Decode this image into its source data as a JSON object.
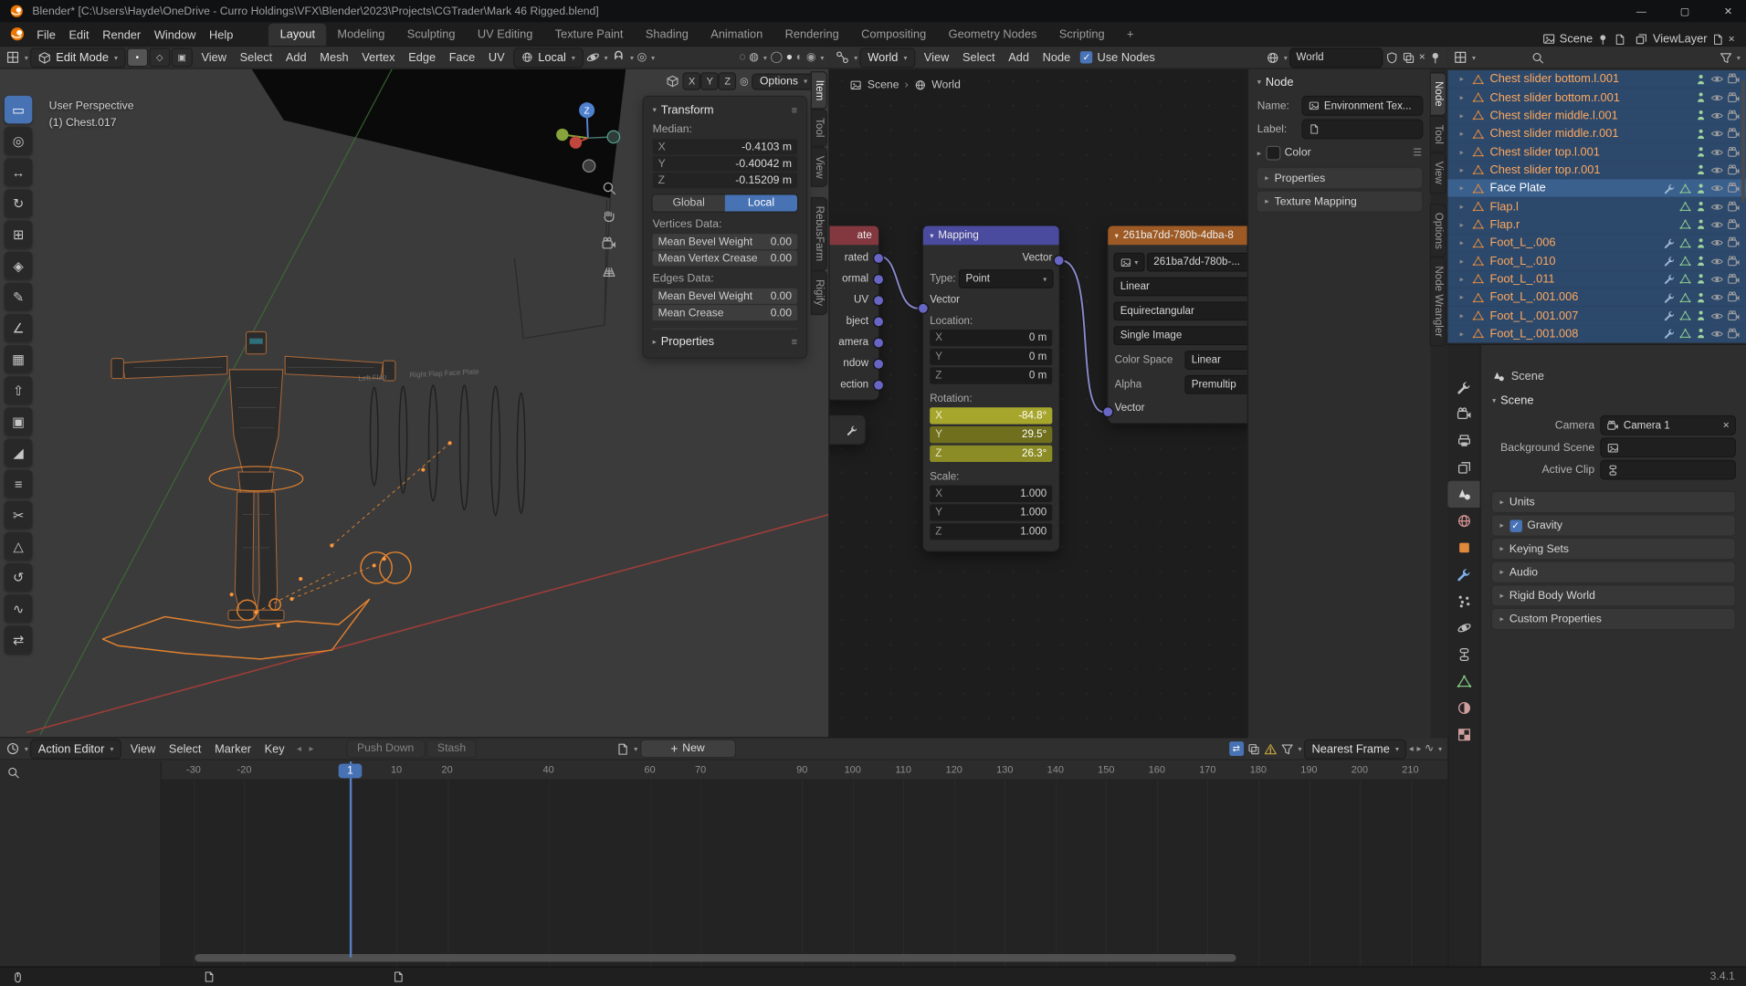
{
  "window": {
    "title": "Blender* [C:\\Users\\Hayde\\OneDrive - Curro Holdings\\VFX\\Blender\\2023\\Projects\\CGTrader\\Mark 46 Rigged.blend]"
  },
  "topbar": {
    "menus": [
      "File",
      "Edit",
      "Render",
      "Window",
      "Help"
    ],
    "workspaces": [
      "Layout",
      "Modeling",
      "Sculpting",
      "UV Editing",
      "Texture Paint",
      "Shading",
      "Animation",
      "Rendering",
      "Compositing",
      "Geometry Nodes",
      "Scripting"
    ],
    "active_workspace": "Layout",
    "add_tab": "+",
    "scene": "Scene",
    "viewlayer": "ViewLayer"
  },
  "viewport": {
    "mode": "Edit Mode",
    "menus": [
      "View",
      "Select",
      "Add",
      "Mesh",
      "Vertex",
      "Edge",
      "Face",
      "UV"
    ],
    "orientation": "Local",
    "mirror": [
      "X",
      "Y",
      "Z"
    ],
    "options": "Options",
    "overlay": {
      "line1": "User Perspective",
      "line2": "(1) Chest.017"
    },
    "gizmo_label": "Z",
    "scene_labels": [
      "Left Flap",
      "Right Flap Face Plate"
    ],
    "tools": [
      "select-box",
      "cursor",
      "move",
      "rotate",
      "scale",
      "transform",
      "annotate",
      "measure",
      "add-cube",
      "extrude-region",
      "inset-faces",
      "bevel",
      "loop-cut",
      "knife",
      "poly-build",
      "spin",
      "smooth",
      "edge-slide"
    ],
    "side_tabs": [
      "Item",
      "Tool",
      "View",
      "RebusFarm",
      "Rigify"
    ],
    "active_side_tab": "Item",
    "panel": {
      "title": "Transform",
      "median_label": "Median:",
      "median": [
        {
          "axis": "X",
          "value": "-0.4103 m"
        },
        {
          "axis": "Y",
          "value": "-0.40042 m"
        },
        {
          "axis": "Z",
          "value": "-0.15209 m"
        }
      ],
      "global_btn": "Global",
      "local_btn": "Local",
      "vertices_label": "Vertices Data:",
      "vertex_rows": [
        {
          "label": "Mean Bevel Weight",
          "value": "0.00"
        },
        {
          "label": "Mean Vertex Crease",
          "value": "0.00"
        }
      ],
      "edges_label": "Edges Data:",
      "edge_rows": [
        {
          "label": "Mean Bevel Weight",
          "value": "0.00"
        },
        {
          "label": "Mean Crease",
          "value": "0.00"
        }
      ],
      "properties": "Properties"
    }
  },
  "node_editor": {
    "header": {
      "shader_type": "World",
      "menus": [
        "View",
        "Select",
        "Add",
        "Node"
      ],
      "use_nodes": "Use Nodes",
      "datablock": "World"
    },
    "breadcrumb": {
      "scene": "Scene",
      "world": "World"
    },
    "texcoord_node": {
      "title": "ate",
      "outputs": [
        "rated",
        "ormal",
        "UV",
        "bject",
        "amera",
        "ndow",
        "ection"
      ]
    },
    "mapping_node": {
      "title": "Mapping",
      "output": "Vector",
      "type_label": "Type:",
      "type": "Point",
      "input": "Vector",
      "location_label": "Location:",
      "location": [
        {
          "axis": "X",
          "value": "0 m"
        },
        {
          "axis": "Y",
          "value": "0 m"
        },
        {
          "axis": "Z",
          "value": "0 m"
        }
      ],
      "rotation_label": "Rotation:",
      "rotation": [
        {
          "axis": "X",
          "value": "-84.8°"
        },
        {
          "axis": "Y",
          "value": "29.5°"
        },
        {
          "axis": "Z",
          "value": "26.3°"
        }
      ],
      "scale_label": "Scale:",
      "scale": [
        {
          "axis": "X",
          "value": "1.000"
        },
        {
          "axis": "Y",
          "value": "1.000"
        },
        {
          "axis": "Z",
          "value": "1.000"
        }
      ]
    },
    "env_node": {
      "title": "261ba7dd-780b-4dba-8",
      "image": "261ba7dd-780b-...",
      "interpolation": "Linear",
      "projection": "Equirectangular",
      "source": "Single Image",
      "color_space_label": "Color Space",
      "color_space": "Linear",
      "alpha_label": "Alpha",
      "alpha": "Premultip",
      "input": "Vector"
    },
    "sidebar": {
      "panel": "Node",
      "name_label": "Name:",
      "name": "Environment Tex...",
      "label_label": "Label:",
      "color": "Color",
      "properties": "Properties",
      "texture_mapping": "Texture Mapping"
    },
    "side_tabs": [
      "Node",
      "Tool",
      "View",
      "Options",
      "Node Wrangler"
    ],
    "active_side_tab": "Node"
  },
  "outliner": {
    "rows": [
      {
        "name": "Chest slider bottom.l.001",
        "state": "selected",
        "icons": [
          "pose"
        ]
      },
      {
        "name": "Chest slider bottom.r.001",
        "state": "selected",
        "icons": [
          "pose"
        ]
      },
      {
        "name": "Chest slider middle.l.001",
        "state": "selected",
        "icons": [
          "pose"
        ]
      },
      {
        "name": "Chest slider middle.r.001",
        "state": "selected",
        "icons": [
          "pose"
        ]
      },
      {
        "name": "Chest slider top.l.001",
        "state": "selected",
        "icons": [
          "pose"
        ]
      },
      {
        "name": "Chest slider top.r.001",
        "state": "selected",
        "icons": [
          "pose"
        ]
      },
      {
        "name": "Face Plate",
        "state": "active",
        "icons": [
          "wrench",
          "tri",
          "pose"
        ]
      },
      {
        "name": "Flap.l",
        "state": "selected",
        "icons": [
          "tri",
          "pose"
        ]
      },
      {
        "name": "Flap.r",
        "state": "selected",
        "icons": [
          "tri",
          "pose"
        ]
      },
      {
        "name": "Foot_L_.006",
        "state": "selected",
        "icons": [
          "wrench",
          "tri",
          "pose"
        ]
      },
      {
        "name": "Foot_L_.010",
        "state": "selected",
        "icons": [
          "wrench",
          "tri",
          "pose"
        ]
      },
      {
        "name": "Foot_L_.011",
        "state": "selected",
        "icons": [
          "wrench",
          "tri",
          "pose"
        ]
      },
      {
        "name": "Foot_L_.001.006",
        "state": "selected",
        "icons": [
          "wrench",
          "tri",
          "pose"
        ]
      },
      {
        "name": "Foot_L_.001.007",
        "state": "selected",
        "icons": [
          "wrench",
          "tri",
          "pose"
        ]
      },
      {
        "name": "Foot_L_.001.008",
        "state": "selected",
        "icons": [
          "wrench",
          "tri",
          "pose"
        ]
      }
    ]
  },
  "properties": {
    "breadcrumb": "Scene",
    "section": "Scene",
    "camera_label": "Camera",
    "camera": "Camera 1",
    "background_label": "Background Scene",
    "clip_label": "Active Clip",
    "panels": [
      "Units",
      "Gravity",
      "Keying Sets",
      "Audio",
      "Rigid Body World",
      "Custom Properties"
    ],
    "tabs": [
      "tool",
      "render",
      "output",
      "view-layer",
      "scene",
      "world",
      "object",
      "modifiers",
      "particles",
      "physics",
      "constraints",
      "object-data",
      "material",
      "texture"
    ],
    "active_tab": "scene"
  },
  "dope_sheet": {
    "mode": "Action Editor",
    "menus": [
      "View",
      "Select",
      "Marker",
      "Key"
    ],
    "push_down": "Push Down",
    "stash": "Stash",
    "new_btn": "New",
    "snap": "Nearest Frame",
    "current_frame": "1",
    "frames": [
      -30,
      -20,
      10,
      20,
      40,
      60,
      70,
      90,
      100,
      110,
      120,
      130,
      140,
      150,
      160,
      170,
      180,
      190,
      200,
      210
    ]
  },
  "status": {
    "version": "3.4.1"
  }
}
